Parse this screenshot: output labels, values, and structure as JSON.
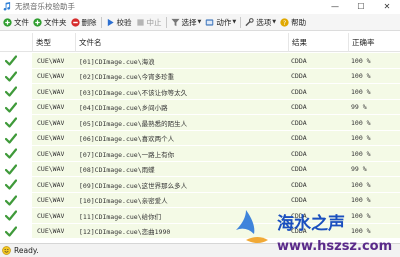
{
  "window": {
    "title": "无损音乐校验助手",
    "controls": {
      "minimize": "—",
      "maximize": "☐",
      "close": "✕"
    }
  },
  "toolbar": {
    "file": "文件",
    "folder": "文件夹",
    "delete": "删除",
    "verify": "校验",
    "stop": "中止",
    "select": "选择",
    "action": "动作",
    "options": "选项",
    "help": "帮助"
  },
  "columns": {
    "type": "类型",
    "filename": "文件名",
    "result": "结果",
    "accuracy": "正确率"
  },
  "rows": [
    {
      "type": "CUE\\WAV",
      "filename": "[01]CDImage.cue\\海浪",
      "result": "CDDA",
      "accuracy": "100 %"
    },
    {
      "type": "CUE\\WAV",
      "filename": "[02]CDImage.cue\\今宵多珍重",
      "result": "CDDA",
      "accuracy": "100 %"
    },
    {
      "type": "CUE\\WAV",
      "filename": "[03]CDImage.cue\\不该让你等太久",
      "result": "CDDA",
      "accuracy": "100 %"
    },
    {
      "type": "CUE\\WAV",
      "filename": "[04]CDImage.cue\\乡间小路",
      "result": "CDDA",
      "accuracy": "99 %"
    },
    {
      "type": "CUE\\WAV",
      "filename": "[05]CDImage.cue\\最熟悉的陌生人",
      "result": "CDDA",
      "accuracy": "100 %"
    },
    {
      "type": "CUE\\WAV",
      "filename": "[06]CDImage.cue\\喜欢两个人",
      "result": "CDDA",
      "accuracy": "100 %"
    },
    {
      "type": "CUE\\WAV",
      "filename": "[07]CDImage.cue\\一路上有你",
      "result": "CDDA",
      "accuracy": "100 %"
    },
    {
      "type": "CUE\\WAV",
      "filename": "[08]CDImage.cue\\雨蝶",
      "result": "CDDA",
      "accuracy": "99 %"
    },
    {
      "type": "CUE\\WAV",
      "filename": "[09]CDImage.cue\\这世界那么多人",
      "result": "CDDA",
      "accuracy": "100 %"
    },
    {
      "type": "CUE\\WAV",
      "filename": "[10]CDImage.cue\\亲密爱人",
      "result": "CDDA",
      "accuracy": "100 %"
    },
    {
      "type": "CUE\\WAV",
      "filename": "[11]CDImage.cue\\给你们",
      "result": "CDDA",
      "accuracy": "100 %"
    },
    {
      "type": "CUE\\WAV",
      "filename": "[12]CDImage.cue\\恋曲1990",
      "result": "CDDA",
      "accuracy": "100 %"
    }
  ],
  "status": {
    "text": "Ready."
  },
  "watermark": {
    "text": "海水之声",
    "url": "www.hszsz.com"
  },
  "colors": {
    "row_bg": "#f4fae6",
    "check": "#3f9a3a",
    "delete": "#d62b2b",
    "verify": "#2c6fd1",
    "add": "#2f9e2f"
  },
  "icons": {
    "app": "music-note-icon",
    "row": "check-icon",
    "file": "add-icon",
    "folder": "folder-icon",
    "delete": "delete-icon",
    "verify": "play-icon",
    "stop": "stop-icon",
    "select": "filter-icon",
    "action": "action-icon",
    "options": "options-icon",
    "help": "help-icon",
    "status": "smile-icon"
  }
}
